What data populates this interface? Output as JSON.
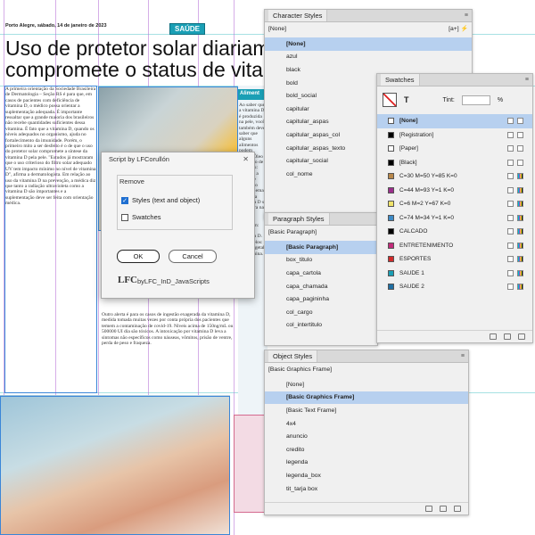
{
  "document": {
    "dateline": "Porto Alegre, sábado, 14 de janeiro de 2023",
    "section_tag": "SAÚDE",
    "headline_line1": "Uso de protetor solar diariamen",
    "headline_line2": "compromete o status de vitamin",
    "body_col1": "A primeira orientação da Sociedade Brasileira de Dermatologia – Seção RS é para que, em casos de pacientes com deficiência de vitamina D, o médico possa orientar a suplementação adequada. É importante ressaltar que a grande maioria dos brasileiros não recebe quantidades suficientes dessa vitamina. É fato que a vitamina D, quando os níveis adequados no organismo, ajuda no fortalecimento da imunidade. Porém, o primeiro mito a ser desfeito é o de que o uso do protetor solar compromete a síntese da vitamina D pela pele. \"Estudos já mostraram que o uso criterioso do filtro solar adequado UV tem impacto mínimo no nível de vitamina D\", afirma a dermatologista. Em relação ao uso da vitamina D na prevenção, a médica diz que tanto a radiação ultravioleta como a vitamina D são importantes e a suplementação deve ser feita com orientação médica.",
    "body_col2": "Outro alerta é para os casos de ingestão exagerada da vitamina D, medida tomada muitas vezes por conta própria dos pacientes que temem a contaminação de covid-19. Níveis acima de 150ng/mL ou 500000 UI dia são tóxicos. A intoxicação por vitamina D leva a sintomas não específicos como náuseas, vômitos, prisão de ventre, perda de peso e fraqueza.",
    "sidebar_title": "Aliment",
    "sidebar_text": "Ao saber que a vitamina D é produzida na pele, você também deve saber que alguns alimentos podem ajudar. Óleo de fígado de bacalhau: extraído a partir do fígado do peixe. Gema de ovo: a vitamina D se concentra na gema. Salmão selvagem: rico em vitamina D. Cogumelos: fonte vegetal da vitamina."
  },
  "character_styles": {
    "title": "Character Styles",
    "current": "[None]",
    "items": [
      "[None]",
      "azul",
      "black",
      "bold",
      "bold_social",
      "capitular",
      "capitular_aspas",
      "capitular_aspas_col",
      "capitular_aspas_texto",
      "capitular_social",
      "col_nome"
    ]
  },
  "paragraph_styles": {
    "title": "Paragraph Styles",
    "current": "[Basic Paragraph]",
    "items": [
      "[Basic Paragraph]",
      "box_titulo",
      "capa_cartola",
      "capa_chamada",
      "capa_pagininha",
      "col_cargo",
      "col_intertitulo"
    ]
  },
  "object_styles": {
    "title": "Object Styles",
    "current": "[Basic Graphics Frame]",
    "items": [
      "[None]",
      "[Basic Graphics Frame]",
      "[Basic Text Frame]",
      "4x4",
      "anuncio",
      "credito",
      "legenda",
      "legenda_box",
      "tit_tarja box"
    ]
  },
  "swatches": {
    "title": "Swatches",
    "tint_label": "Tint:",
    "tint_unit": "%",
    "items": [
      {
        "name": "[None]",
        "color": "#ffffff"
      },
      {
        "name": "[Registration]",
        "color": "#000000"
      },
      {
        "name": "[Paper]",
        "color": "#ffffff"
      },
      {
        "name": "[Black]",
        "color": "#000000"
      },
      {
        "name": "C=30 M=50 Y=85 K=0",
        "color": "#b8874a"
      },
      {
        "name": "C=44 M=93 Y=1 K=0",
        "color": "#9c2e8c"
      },
      {
        "name": "C=6 M=2 Y=67 K=0",
        "color": "#f0e36a"
      },
      {
        "name": "C=74 M=34 Y=1 K=0",
        "color": "#3d8ac6"
      },
      {
        "name": "CALCADO",
        "color": "#000000"
      },
      {
        "name": "ENTRETENIMENTO",
        "color": "#c22a7a"
      },
      {
        "name": "ESPORTES",
        "color": "#d12a2a"
      },
      {
        "name": "SAUDE 1",
        "color": "#1a9fb5"
      },
      {
        "name": "SAUDE 2",
        "color": "#1f6fa3"
      }
    ]
  },
  "dialog": {
    "title": "Script by LFCorullón",
    "group_label": "Remove",
    "option1_label": "Styles (text and object)",
    "option1_checked": true,
    "option2_label": "Swatches",
    "option2_checked": false,
    "ok_label": "OK",
    "cancel_label": "Cancel",
    "logo": "LFC",
    "credit": "byLFC_InD_JavaScripts"
  },
  "colors": {
    "selection": "#b7d0ef",
    "accent": "#1a9fb5",
    "checkbox_on": "#1f6fd1"
  }
}
